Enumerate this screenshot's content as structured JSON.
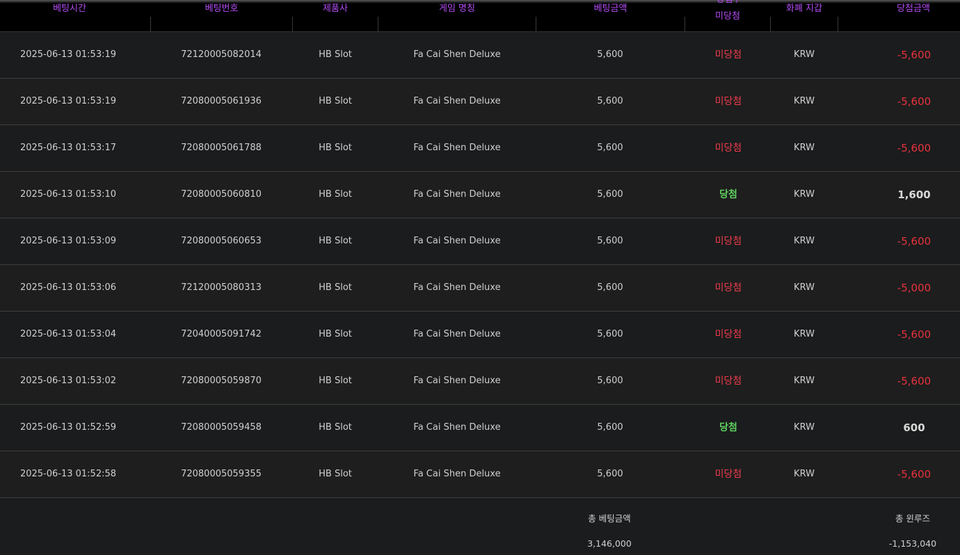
{
  "headers": {
    "bet_time": "베팅시간",
    "bet_no": "베팅번호",
    "provider": "제품사",
    "game": "게임 명칭",
    "bet_amount": "베팅금액",
    "result_line1": "당첨 /",
    "result_line2": "미당첨",
    "currency": "화폐 지갑",
    "win_amount": "당첨금액"
  },
  "rows": [
    {
      "time": "2025-06-13 01:53:19",
      "no": "72120005082014",
      "provider": "HB Slot",
      "game": "Fa Cai Shen Deluxe",
      "bet": "5,600",
      "result": "미당첨",
      "currency": "KRW",
      "amount": "-5,600"
    },
    {
      "time": "2025-06-13 01:53:19",
      "no": "72080005061936",
      "provider": "HB Slot",
      "game": "Fa Cai Shen Deluxe",
      "bet": "5,600",
      "result": "미당첨",
      "currency": "KRW",
      "amount": "-5,600"
    },
    {
      "time": "2025-06-13 01:53:17",
      "no": "72080005061788",
      "provider": "HB Slot",
      "game": "Fa Cai Shen Deluxe",
      "bet": "5,600",
      "result": "미당첨",
      "currency": "KRW",
      "amount": "-5,600"
    },
    {
      "time": "2025-06-13 01:53:10",
      "no": "72080005060810",
      "provider": "HB Slot",
      "game": "Fa Cai Shen Deluxe",
      "bet": "5,600",
      "result": "당첨",
      "currency": "KRW",
      "amount": "1,600"
    },
    {
      "time": "2025-06-13 01:53:09",
      "no": "72080005060653",
      "provider": "HB Slot",
      "game": "Fa Cai Shen Deluxe",
      "bet": "5,600",
      "result": "미당첨",
      "currency": "KRW",
      "amount": "-5,600"
    },
    {
      "time": "2025-06-13 01:53:06",
      "no": "72120005080313",
      "provider": "HB Slot",
      "game": "Fa Cai Shen Deluxe",
      "bet": "5,600",
      "result": "미당첨",
      "currency": "KRW",
      "amount": "-5,000"
    },
    {
      "time": "2025-06-13 01:53:04",
      "no": "72040005091742",
      "provider": "HB Slot",
      "game": "Fa Cai Shen Deluxe",
      "bet": "5,600",
      "result": "미당첨",
      "currency": "KRW",
      "amount": "-5,600"
    },
    {
      "time": "2025-06-13 01:53:02",
      "no": "72080005059870",
      "provider": "HB Slot",
      "game": "Fa Cai Shen Deluxe",
      "bet": "5,600",
      "result": "미당첨",
      "currency": "KRW",
      "amount": "-5,600"
    },
    {
      "time": "2025-06-13 01:52:59",
      "no": "72080005059458",
      "provider": "HB Slot",
      "game": "Fa Cai Shen Deluxe",
      "bet": "5,600",
      "result": "당첨",
      "currency": "KRW",
      "amount": "600"
    },
    {
      "time": "2025-06-13 01:52:58",
      "no": "72080005059355",
      "provider": "HB Slot",
      "game": "Fa Cai Shen Deluxe",
      "bet": "5,600",
      "result": "미당첨",
      "currency": "KRW",
      "amount": "-5,600"
    }
  ],
  "footer": {
    "total_bet_label": "총 베팅금액",
    "total_bet_value": "3,146,000",
    "total_winloss_label": "총 윈루즈",
    "total_winloss_value": "-1,153,040"
  },
  "colors": {
    "header_text": "#b54cf5",
    "lose": "#ee3b4c",
    "win": "#5fd05f"
  }
}
